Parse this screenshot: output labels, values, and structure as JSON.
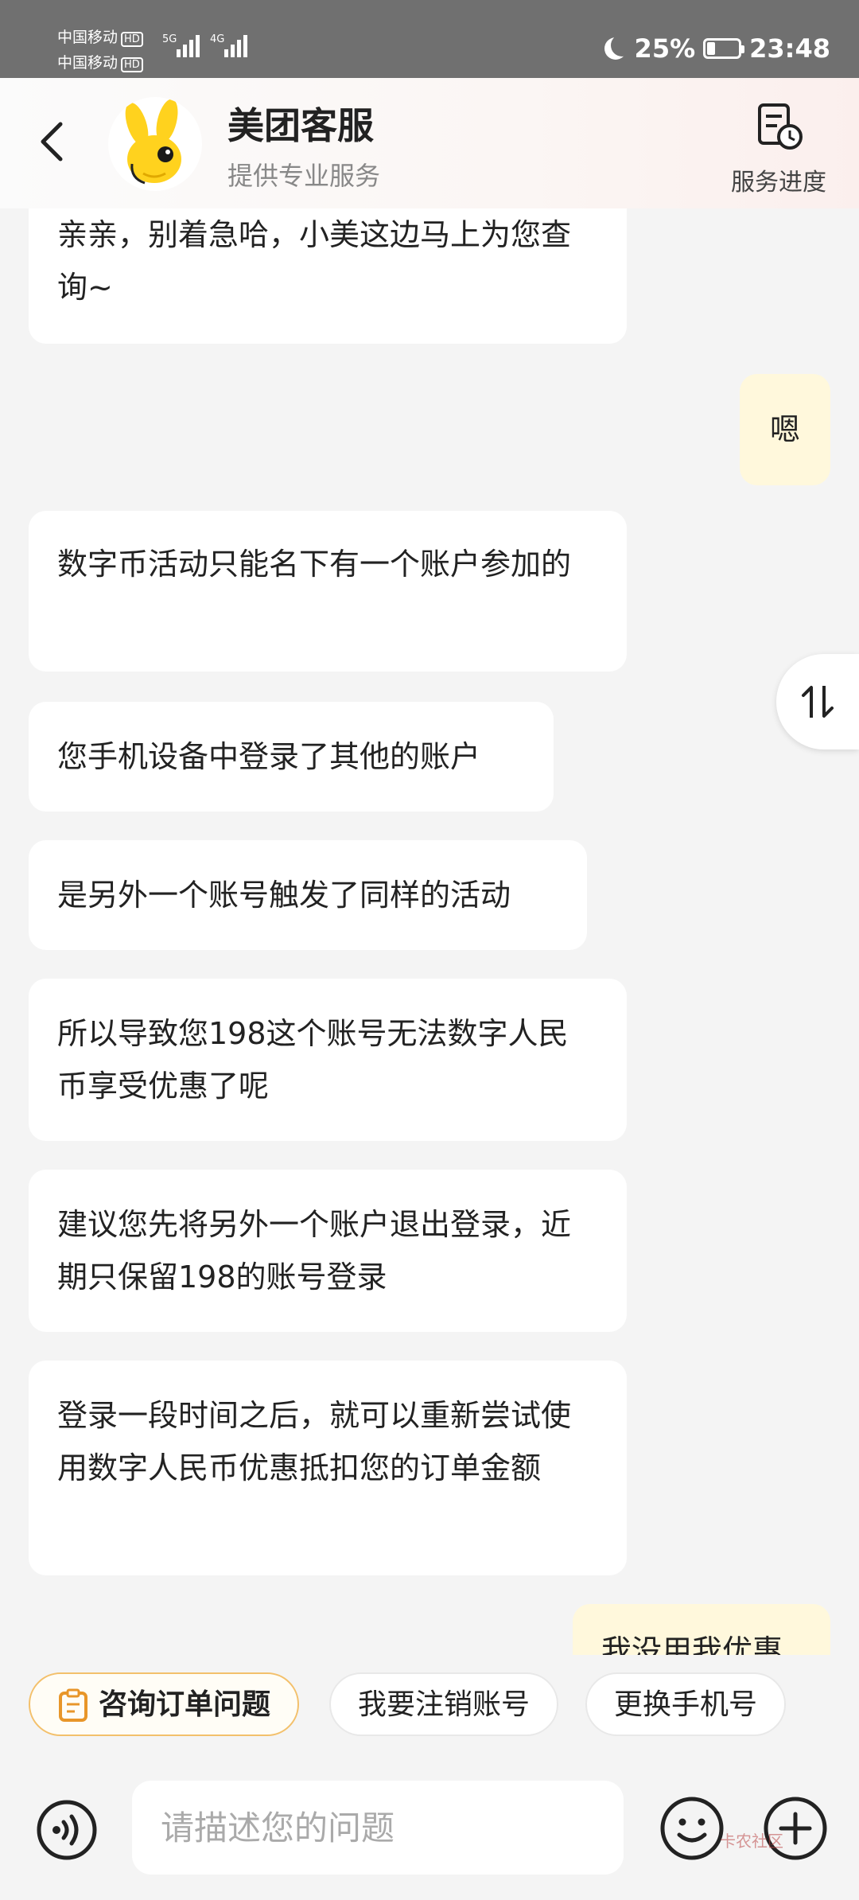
{
  "status_bar": {
    "carrier1": "中国移动",
    "carrier2": "中国移动",
    "hd_badge": "HD",
    "signal1_label": "5G",
    "signal2_label": "4G",
    "battery": "25%",
    "time": "23:48"
  },
  "header": {
    "title": "美团客服",
    "subtitle": "提供专业服务",
    "progress_label": "服务进度"
  },
  "messages": [
    {
      "from": "agent",
      "text": "亲亲，别着急哈，小美这边马上为您查询~"
    },
    {
      "from": "user",
      "text": "嗯"
    },
    {
      "from": "agent",
      "text": "数字币活动只能名下有一个账户参加的"
    },
    {
      "from": "agent",
      "text": "您手机设备中登录了其他的账户"
    },
    {
      "from": "agent",
      "text": "是另外一个账号触发了同样的活动"
    },
    {
      "from": "agent",
      "text": "所以导致您198这个账号无法数字人民币享受优惠了呢"
    },
    {
      "from": "agent",
      "text": "建议您先将另外一个账户退出登录，近期只保留198的账号登录"
    },
    {
      "from": "agent",
      "text": "登录一段时间之后，就可以重新尝试使用数字人民币优惠抵扣您的订单金额"
    },
    {
      "from": "user",
      "text": "我没用我优惠"
    }
  ],
  "quick_replies": [
    "咨询订单问题",
    "我要注销账号",
    "更换手机号"
  ],
  "input": {
    "placeholder": "请描述您的问题"
  },
  "watermark": "卡农社区",
  "colors": {
    "status_bar": "#707070",
    "user_bubble": "#fff8dc",
    "chip_accent": "#f3c06b",
    "mascot_yellow": "#ffd21e"
  }
}
